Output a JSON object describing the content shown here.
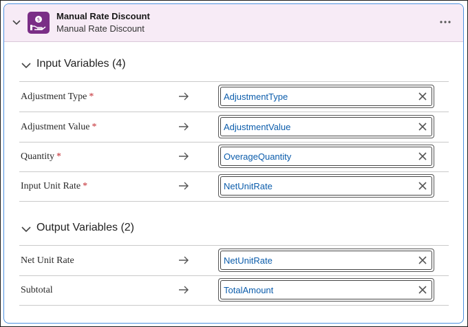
{
  "header": {
    "title": "Manual Rate Discount",
    "subtitle": "Manual Rate Discount"
  },
  "input_section": {
    "title": "Input Variables (4)",
    "rows": [
      {
        "label": "Adjustment Type",
        "required": "*",
        "value": "AdjustmentType"
      },
      {
        "label": "Adjustment Value",
        "required": "*",
        "value": "AdjustmentValue"
      },
      {
        "label": "Quantity",
        "required": "*",
        "value": "OverageQuantity"
      },
      {
        "label": "Input Unit Rate",
        "required": "*",
        "value": "NetUnitRate"
      }
    ]
  },
  "output_section": {
    "title": "Output Variables (2)",
    "rows": [
      {
        "label": "Net Unit Rate",
        "value": "NetUnitRate"
      },
      {
        "label": "Subtotal",
        "value": "TotalAmount"
      }
    ]
  },
  "icons": {
    "collapse": "chevron-down-icon",
    "app": "hand-with-coin-icon",
    "more": "more-options-icon",
    "arrow": "arrow-right-icon",
    "clear": "close-icon"
  },
  "colors": {
    "header_bg": "#f7ebf6",
    "app_icon_bg": "#7a2e86",
    "card_border": "#4a8fe0",
    "value_text": "#0b5cab",
    "required": "#c2272d"
  }
}
